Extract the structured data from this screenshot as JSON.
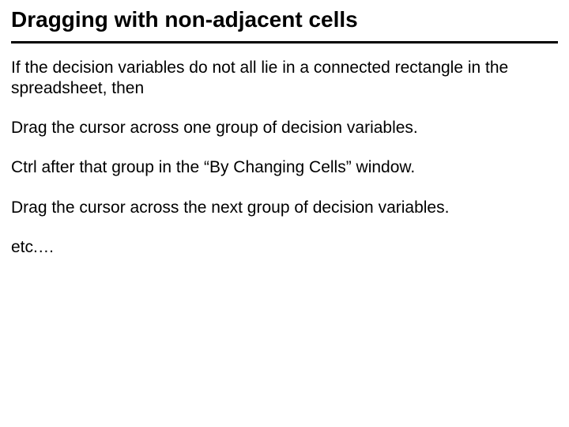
{
  "title": "Dragging with non-adjacent cells",
  "paragraphs": {
    "p1": "If the decision variables do not all lie in a connected rectangle in the spreadsheet, then",
    "p2": "Drag the cursor across one group of decision variables.",
    "p3": "Ctrl   after that group in the “By Changing Cells” window.",
    "p4": "Drag the cursor across the next group of decision variables.",
    "p5": "etc.…"
  }
}
